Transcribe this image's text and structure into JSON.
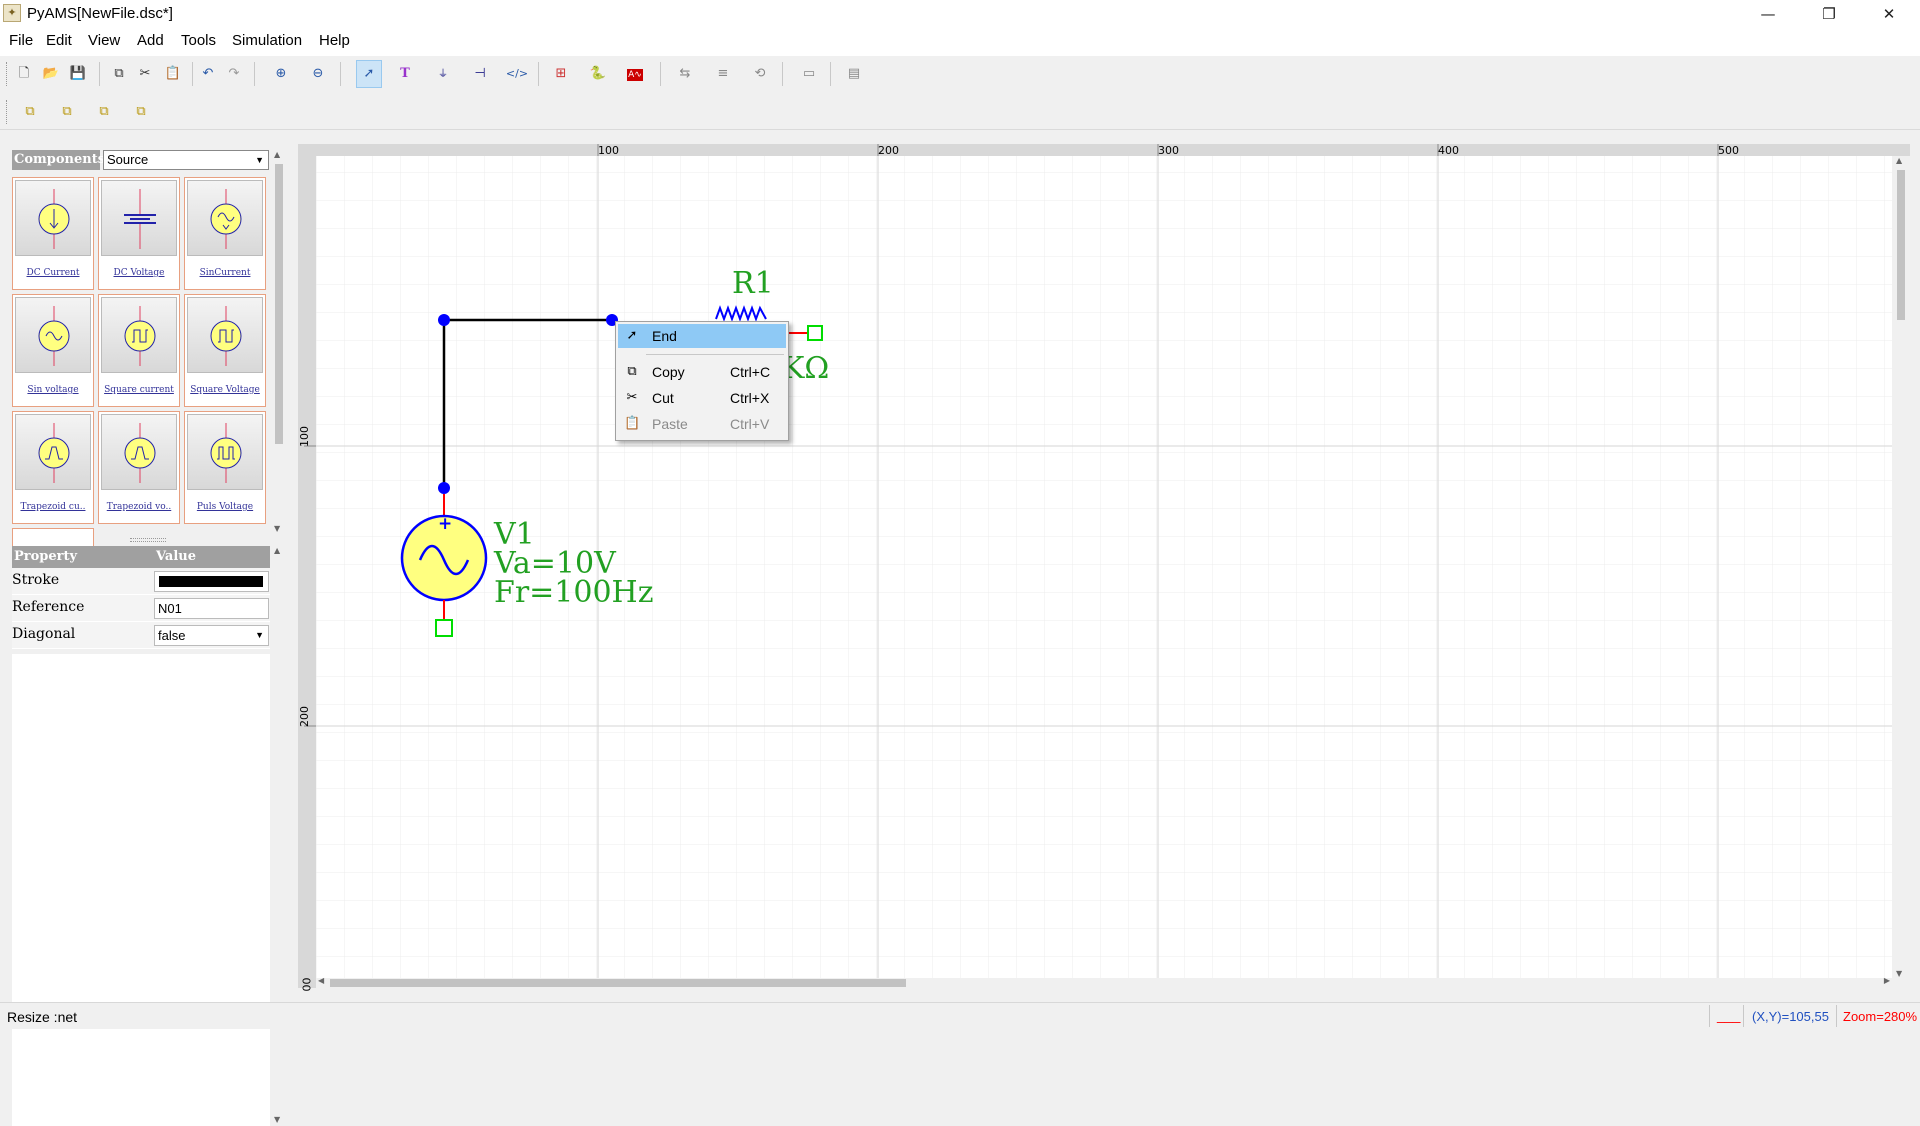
{
  "window": {
    "title": "PyAMS[NewFile.dsc*]",
    "app_icon": "pyams-app-icon",
    "minimize": "—",
    "maximize": "❐",
    "close": "✕"
  },
  "menu": [
    "File",
    "Edit",
    "View",
    "Add",
    "Tools",
    "Simulation",
    "Help"
  ],
  "toolbar": {
    "row1": [
      "new-file",
      "open-file",
      "save",
      "copy",
      "cut",
      "paste",
      "undo",
      "redo",
      "zoom-in",
      "zoom-out",
      "select-pointer",
      "text",
      "ground",
      "port",
      "html",
      "graph-probe",
      "python",
      "analysis",
      "flip-h",
      "align",
      "rotate",
      "image",
      "frame"
    ],
    "row2": [
      "bring-front",
      "send-back",
      "forward",
      "backward"
    ],
    "active": "select-pointer"
  },
  "components": {
    "header": "Components",
    "category": "Source",
    "items": [
      {
        "label": "DC Current",
        "icon": "dc-current-source-icon"
      },
      {
        "label": "DC Voltage",
        "icon": "dc-voltage-source-icon"
      },
      {
        "label": "SinCurrent",
        "icon": "sin-current-source-icon"
      },
      {
        "label": "Sin voltage",
        "icon": "sin-voltage-source-icon"
      },
      {
        "label": "Square current",
        "icon": "square-current-source-icon"
      },
      {
        "label": "Square Voltage",
        "icon": "square-voltage-source-icon"
      },
      {
        "label": "Trapezoid cu..",
        "icon": "trapezoid-current-source-icon"
      },
      {
        "label": "Trapezoid vo..",
        "icon": "trapezoid-voltage-source-icon"
      },
      {
        "label": "Puls Voltage",
        "icon": "pulse-voltage-source-icon"
      }
    ]
  },
  "properties": {
    "header_property": "Property",
    "header_value": "Value",
    "rows": [
      {
        "name": "Stroke",
        "value": "",
        "color": "#000000"
      },
      {
        "name": "Reference",
        "value": "N01"
      },
      {
        "name": "Diagonal",
        "value": "false"
      }
    ]
  },
  "ruler": {
    "top_ticks": [
      "100",
      "200",
      "300",
      "400",
      "500"
    ],
    "left_ticks": [
      "100",
      "200",
      "00"
    ]
  },
  "schematic": {
    "resistor_name": "R1",
    "resistor_value_fragment": "KΩ",
    "source_name": "V1",
    "source_amplitude": "Va=10V",
    "source_frequency": "Fr=100Hz",
    "plus_sign": "+",
    "colors": {
      "wire": "#000000",
      "node": "#0000ff",
      "label": "#22a022",
      "pin": "#ff0000",
      "terminal": "#00dd00",
      "source_fill": "#ffff80"
    }
  },
  "context_menu": {
    "items": [
      {
        "label": "End",
        "shortcut": "",
        "icon": "pointer-icon",
        "highlighted": true
      },
      {
        "label": "Copy",
        "shortcut": "Ctrl+C",
        "icon": "copy-icon"
      },
      {
        "label": "Cut",
        "shortcut": "Ctrl+X",
        "icon": "cut-icon"
      },
      {
        "label": "Paste",
        "shortcut": "Ctrl+V",
        "icon": "paste-icon",
        "disabled": true
      }
    ]
  },
  "status": {
    "message": "Resize :net",
    "indicator": "___",
    "coords": "(X,Y)=105,55",
    "zoom": "Zoom=280%"
  }
}
